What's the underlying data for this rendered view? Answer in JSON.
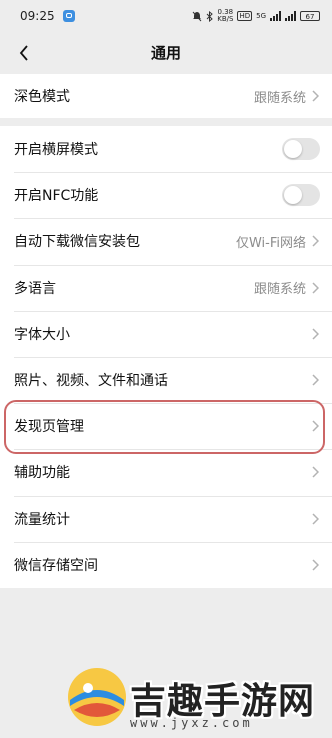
{
  "status_bar": {
    "time": "09:25",
    "speed_value": "0.38",
    "speed_unit": "KB/S",
    "hd": "HD",
    "network": "5G",
    "battery": "67",
    "icons": [
      "wechat-app-icon",
      "mute-bell-icon",
      "bluetooth-icon",
      "signal-icon",
      "signal-icon",
      "battery-icon"
    ]
  },
  "nav": {
    "title": "通用",
    "back_icon": "chevron-left-icon"
  },
  "group1": [
    {
      "label": "深色模式",
      "value": "跟随系统"
    }
  ],
  "settings": {
    "landscape": {
      "label": "开启横屏模式",
      "enabled": false
    },
    "nfc": {
      "label": "开启NFC功能",
      "enabled": false
    },
    "auto_download": {
      "label": "自动下载微信安装包",
      "value": "仅Wi-Fi网络"
    },
    "language": {
      "label": "多语言",
      "value": "跟随系统"
    },
    "font_size": {
      "label": "字体大小"
    },
    "media": {
      "label": "照片、视频、文件和通话"
    },
    "discover": {
      "label": "发现页管理",
      "highlighted": true
    },
    "accessibility": {
      "label": "辅助功能"
    },
    "traffic": {
      "label": "流量统计"
    },
    "storage": {
      "label": "微信存储空间"
    }
  },
  "accent_colors": {
    "highlight": "#cc6666",
    "background": "#ededed"
  },
  "watermark": {
    "title": "吉趣手游网",
    "url": "www.jyxz.com"
  }
}
